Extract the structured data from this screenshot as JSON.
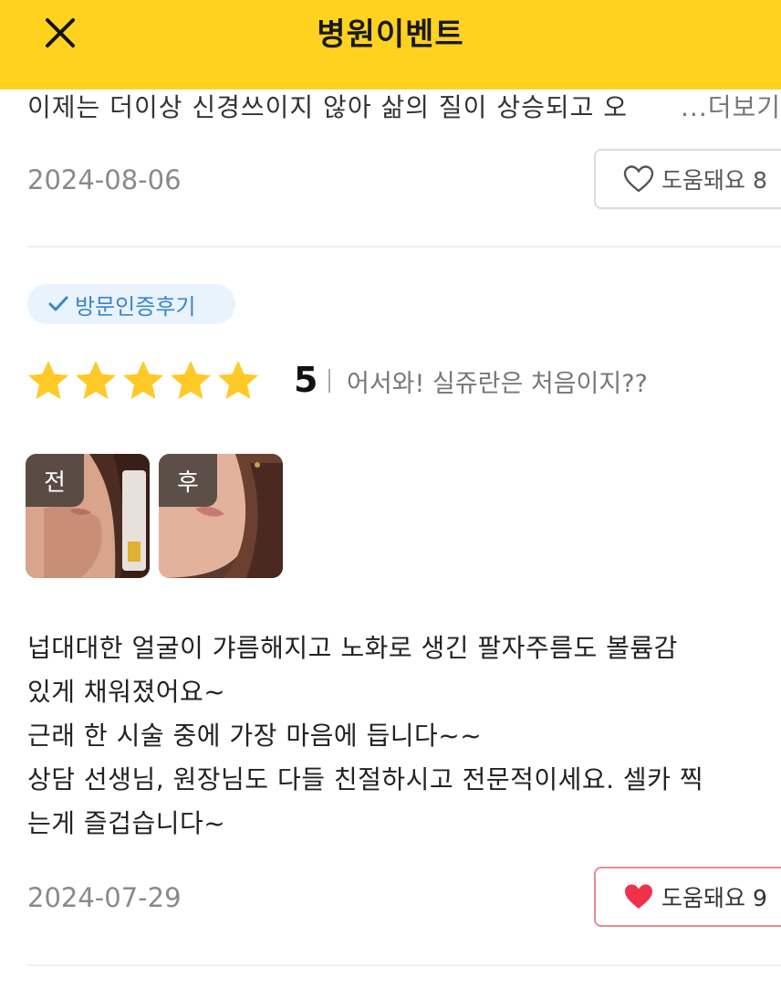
{
  "header": {
    "title": "병원이벤트"
  },
  "prev_review": {
    "text_fragment": "이제는 더이상 신경쓰이지 않아 삶의 질이 상승되고 오",
    "more_label": "...더보기",
    "date": "2024-08-06",
    "helpful_label": "도움돼요 8"
  },
  "review": {
    "badge": "방문인증후기",
    "rating": "5",
    "stars": 5,
    "title": "어서와! 실쥬란은 처음이지??",
    "images": [
      {
        "label": "전"
      },
      {
        "label": "후"
      }
    ],
    "body_lines": [
      "넙대대한 얼굴이 갸름해지고 노화로 생긴 팔자주름도 볼륨감",
      "있게 채워졌어요~",
      "근래 한 시술 중에 가장 마음에 듭니다~~",
      "상담 선생님, 원장님도 다들 친절하시고 전문적이세요. 셀카 찍",
      "는게 즐겁습니다~"
    ],
    "date": "2024-07-29",
    "helpful_label": "도움돼요 9"
  },
  "colors": {
    "header_bg": "#FFD21F",
    "star": "#FFC928",
    "badge_bg": "#E9F3FB",
    "badge_text": "#3A86C8",
    "heart_active": "#F0314A"
  }
}
